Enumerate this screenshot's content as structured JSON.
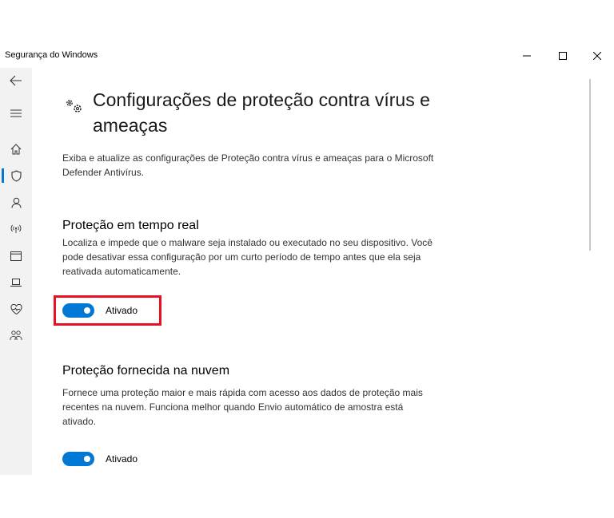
{
  "window": {
    "title": "Segurança do Windows",
    "controls": {
      "minimize": "minimize-icon",
      "maximize": "maximize-icon",
      "close": "close-icon"
    }
  },
  "sidebar": {
    "items": [
      {
        "name": "back",
        "icon": "back-arrow-icon"
      },
      {
        "name": "menu",
        "icon": "hamburger-menu-icon"
      },
      {
        "name": "home",
        "icon": "home-icon"
      },
      {
        "name": "virus-protection",
        "icon": "shield-icon",
        "active": true
      },
      {
        "name": "account-protection",
        "icon": "person-icon"
      },
      {
        "name": "firewall",
        "icon": "wireless-icon"
      },
      {
        "name": "app-browser-control",
        "icon": "browser-window-icon"
      },
      {
        "name": "device-security",
        "icon": "laptop-icon"
      },
      {
        "name": "device-performance",
        "icon": "heart-health-icon"
      },
      {
        "name": "family-options",
        "icon": "family-icon"
      }
    ]
  },
  "page": {
    "icon": "gears-icon",
    "title": "Configurações de proteção contra vírus e ameaças",
    "description": "Exiba e atualize as configurações de Proteção contra vírus e ameaças para o Microsoft Defender Antivírus."
  },
  "sections": [
    {
      "title": "Proteção em tempo real",
      "description": "Localiza e impede que o malware seja instalado ou executado no seu dispositivo. Você pode desativar essa configuração por um curto período de tempo antes que ela seja reativada automaticamente.",
      "toggle_state": "Ativado",
      "toggle_on": true,
      "highlighted": true
    },
    {
      "title": "Proteção fornecida na nuvem",
      "description": "Fornece uma proteção maior e mais rápida com acesso aos dados de proteção mais recentes na nuvem. Funciona melhor quando Envio automático de amostra está ativado.",
      "toggle_state": "Ativado",
      "toggle_on": true
    }
  ],
  "colors": {
    "accent": "#0078d4",
    "highlight": "#e81123",
    "sidebar_bg": "#f2f2f2"
  }
}
